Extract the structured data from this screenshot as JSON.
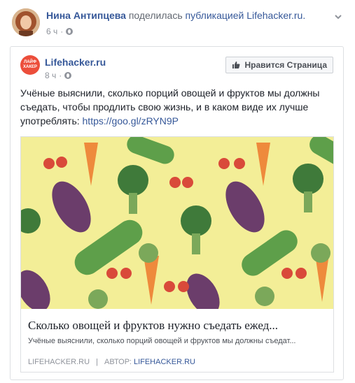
{
  "post": {
    "author": "Нина Антипцева",
    "action": "поделилась",
    "object": "публикацией",
    "source_page": "Lifehacker.ru.",
    "time": "6 ч"
  },
  "shared": {
    "page_logo_text": "ЛАЙФ ХАКЕР",
    "page_name": "Lifehacker.ru",
    "time": "8 ч",
    "like_button": "Нравится Страница",
    "text": "Учёные выяснили, сколько порций овощей и фруктов мы должны съедать, чтобы продлить свою жизнь, и в каком виде их лучше употреблять:",
    "link": "https://goo.gl/zRYN9P"
  },
  "preview": {
    "title": "Сколько овощей и фруктов нужно съедать ежед...",
    "description": "Учёные выяснили, сколько порций овощей и фруктов мы должны съедат...",
    "domain": "LIFEHACKER.RU",
    "author_label": "АВТОР:",
    "author": "LIFEHACKER.RU"
  },
  "icons": {
    "menu": "chevron-down-icon",
    "privacy": "globe-icon",
    "like": "thumbs-up-icon"
  },
  "colors": {
    "link": "#365899",
    "muted": "#90949c",
    "logo": "#ec4e3b",
    "image_bg": "#f3ee97"
  }
}
